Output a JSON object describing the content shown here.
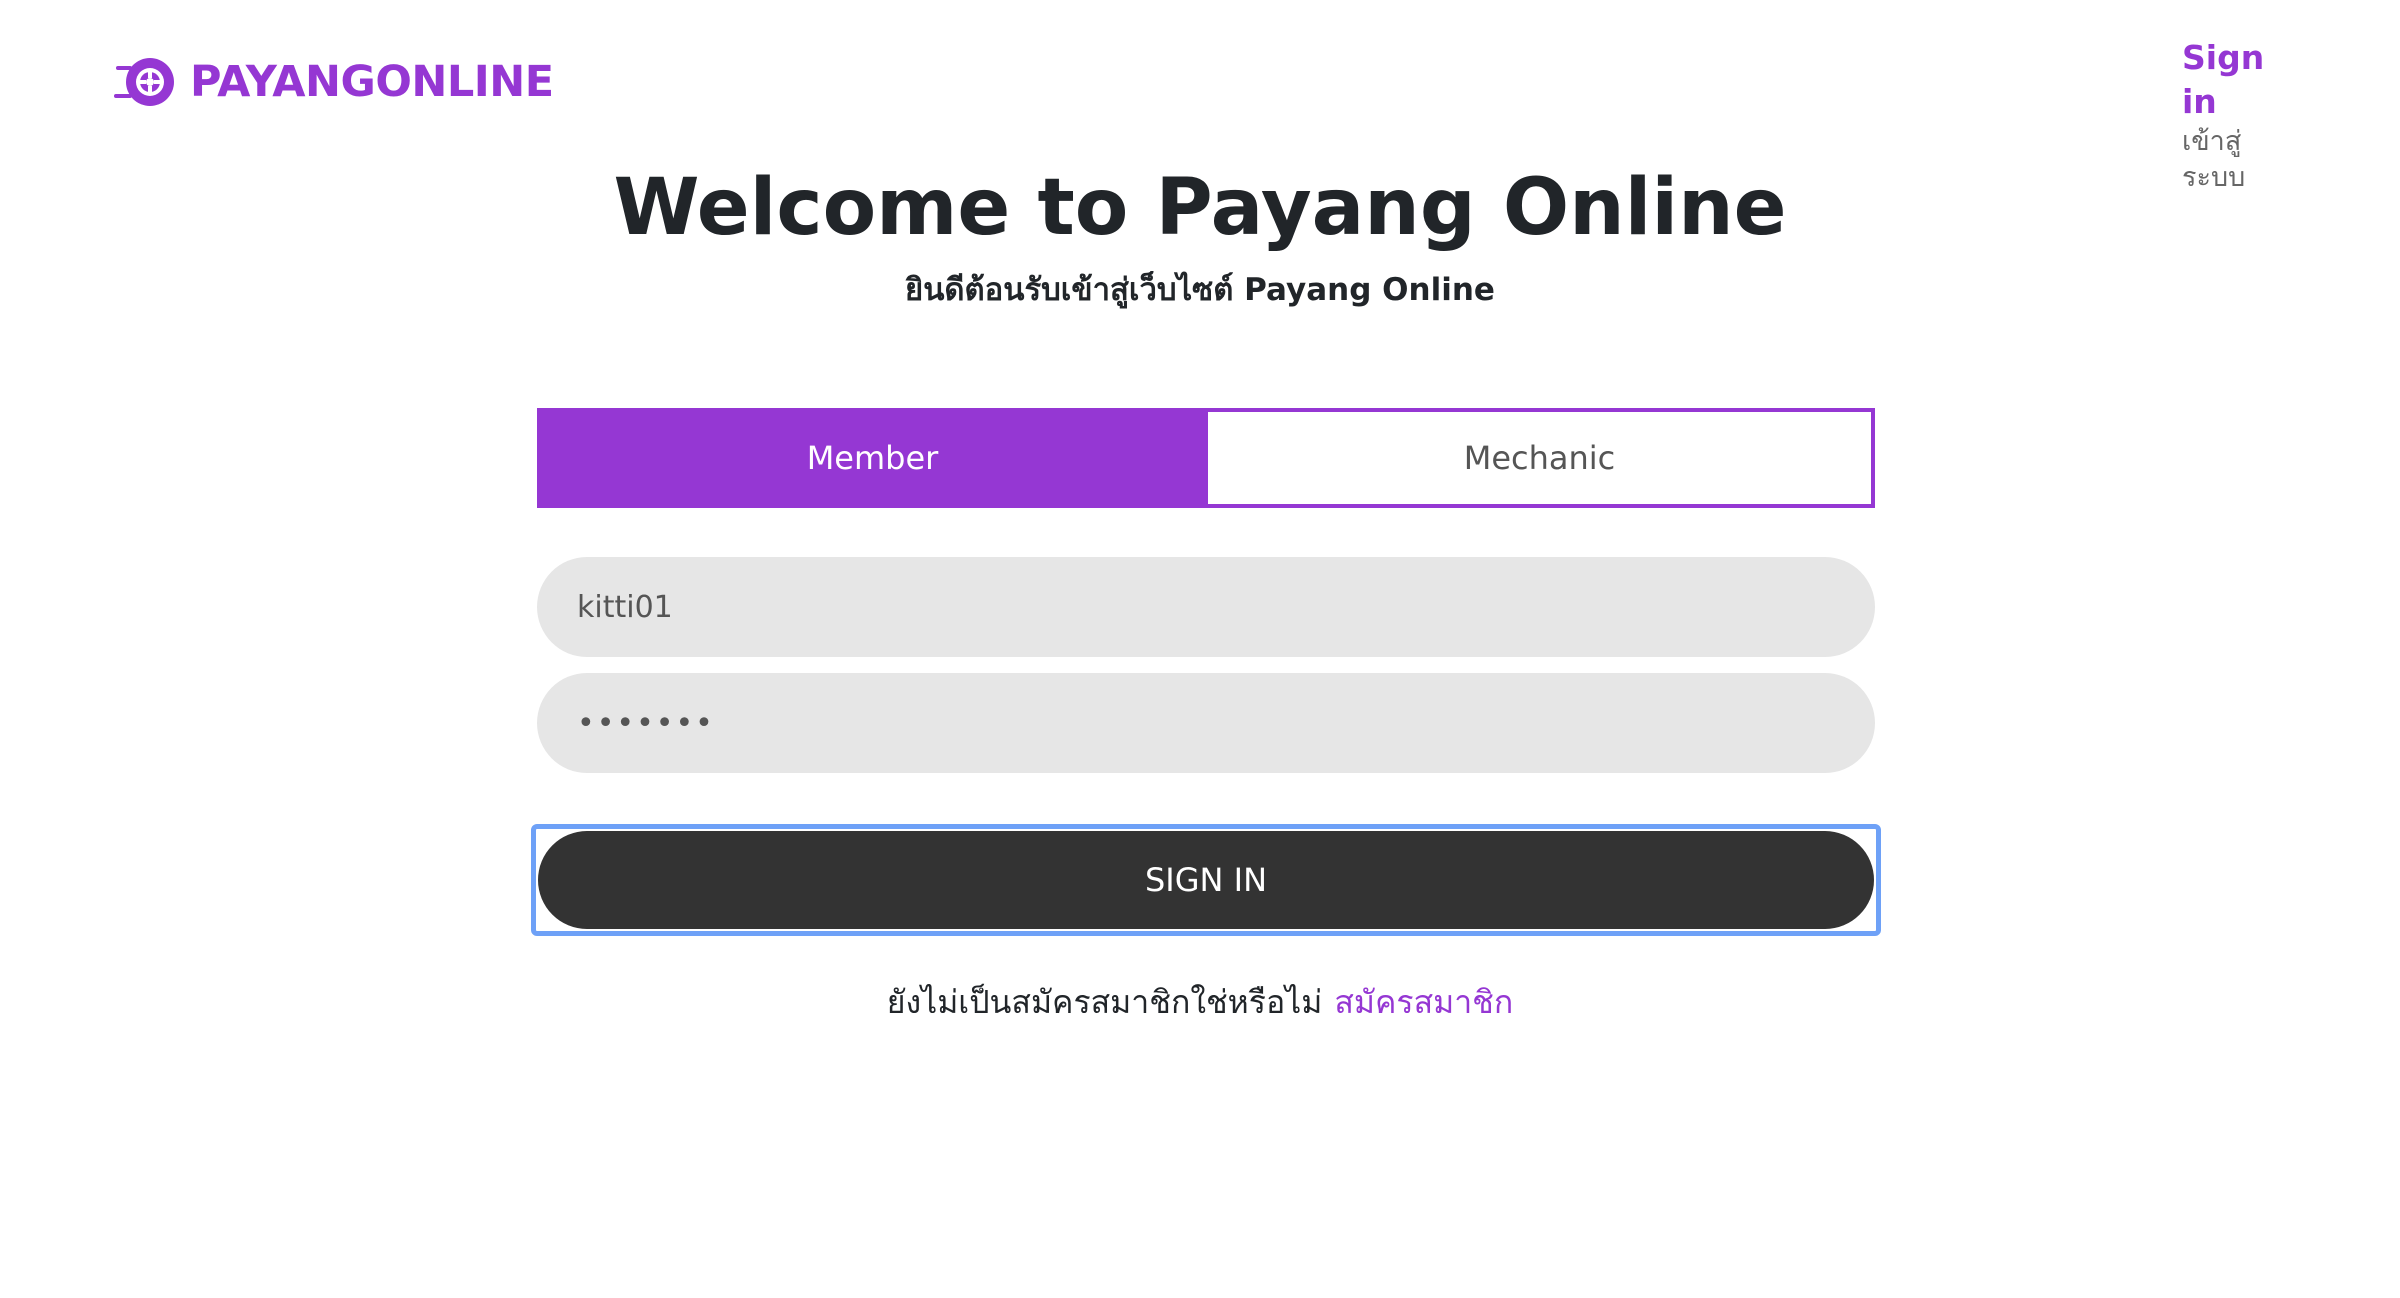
{
  "header": {
    "logo_text": "PAYANGONLINE",
    "logo_icon": "wheel-icon",
    "signin_label": "Sign in",
    "signin_sub": "เข้าสู่ระบบ"
  },
  "main": {
    "title": "Welcome to Payang Online",
    "subtitle": "ยินดีต้อนรับเข้าสู่เว็บไซต์ Payang Online"
  },
  "tabs": [
    {
      "label": "Member",
      "active": true
    },
    {
      "label": "Mechanic",
      "active": false
    }
  ],
  "form": {
    "username_value": "kitti01",
    "password_value": "•••••••",
    "submit_label": "SIGN IN"
  },
  "register": {
    "prompt": "ยังไม่เป็นสมัครสมาชิกใช่หรือไม่",
    "link_label": "สมัครสมาชิก"
  },
  "colors": {
    "brand": "#9537d3",
    "button": "#333333",
    "input_bg": "#e6e6e6",
    "focus_ring": "#6ea1f7"
  }
}
